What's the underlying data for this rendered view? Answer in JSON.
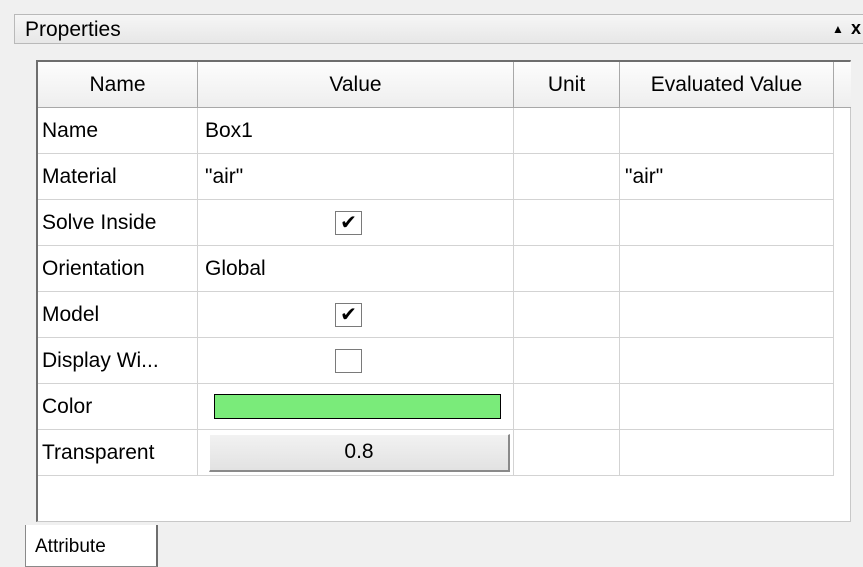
{
  "window": {
    "title": "Properties",
    "pin_glyph": "▲",
    "close_glyph": "x"
  },
  "table": {
    "headers": [
      "Name",
      "Value",
      "Unit",
      "Evaluated Value"
    ],
    "rows": [
      {
        "name": "Name",
        "value": "Box1",
        "unit": "",
        "evaluated": ""
      },
      {
        "name": "Material",
        "value": "\"air\"",
        "unit": "",
        "evaluated": "\"air\""
      },
      {
        "name": "Solve Inside",
        "value": "",
        "unit": "",
        "evaluated": "",
        "checked": true
      },
      {
        "name": "Orientation",
        "value": "Global",
        "unit": "",
        "evaluated": ""
      },
      {
        "name": "Model",
        "value": "",
        "unit": "",
        "evaluated": "",
        "checked": true
      },
      {
        "name": "Display Wi...",
        "value": "",
        "unit": "",
        "evaluated": "",
        "checked": false
      },
      {
        "name": "Color",
        "value": "",
        "unit": "",
        "evaluated": "",
        "color": "#7aeb7a"
      },
      {
        "name": "Transparent",
        "value": "0.8",
        "unit": "",
        "evaluated": ""
      }
    ],
    "check_glyph": "✔"
  },
  "tabs": [
    {
      "label": "Attribute",
      "active": true
    }
  ]
}
